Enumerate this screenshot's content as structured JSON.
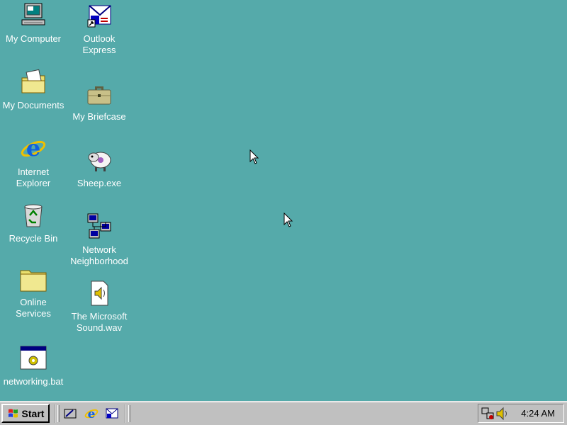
{
  "desktop": {
    "background_color": "#55AAAA",
    "icons": [
      {
        "label": "My Computer",
        "icon": "computer-icon"
      },
      {
        "label": "Outlook\nExpress",
        "icon": "outlook-express-icon"
      },
      {
        "label": "My Documents",
        "icon": "documents-folder-icon"
      },
      {
        "label": "My Briefcase",
        "icon": "briefcase-icon"
      },
      {
        "label": "Internet\nExplorer",
        "icon": "internet-explorer-icon"
      },
      {
        "label": "Sheep.exe",
        "icon": "sheep-icon"
      },
      {
        "label": "Recycle Bin",
        "icon": "recycle-bin-icon"
      },
      {
        "label": "Network\nNeighborhood",
        "icon": "network-icon"
      },
      {
        "label": "Online\nServices",
        "icon": "folder-icon"
      },
      {
        "label": "The Microsoft\nSound.wav",
        "icon": "sound-file-icon"
      },
      {
        "label": "networking.bat",
        "icon": "batch-file-icon"
      }
    ]
  },
  "taskbar": {
    "start_label": "Start",
    "quick_launch": [
      "show-desktop-icon",
      "internet-explorer-icon",
      "outlook-express-icon"
    ],
    "tray_icons": [
      "network-status-icon",
      "volume-icon"
    ],
    "clock": "4:24 AM"
  }
}
